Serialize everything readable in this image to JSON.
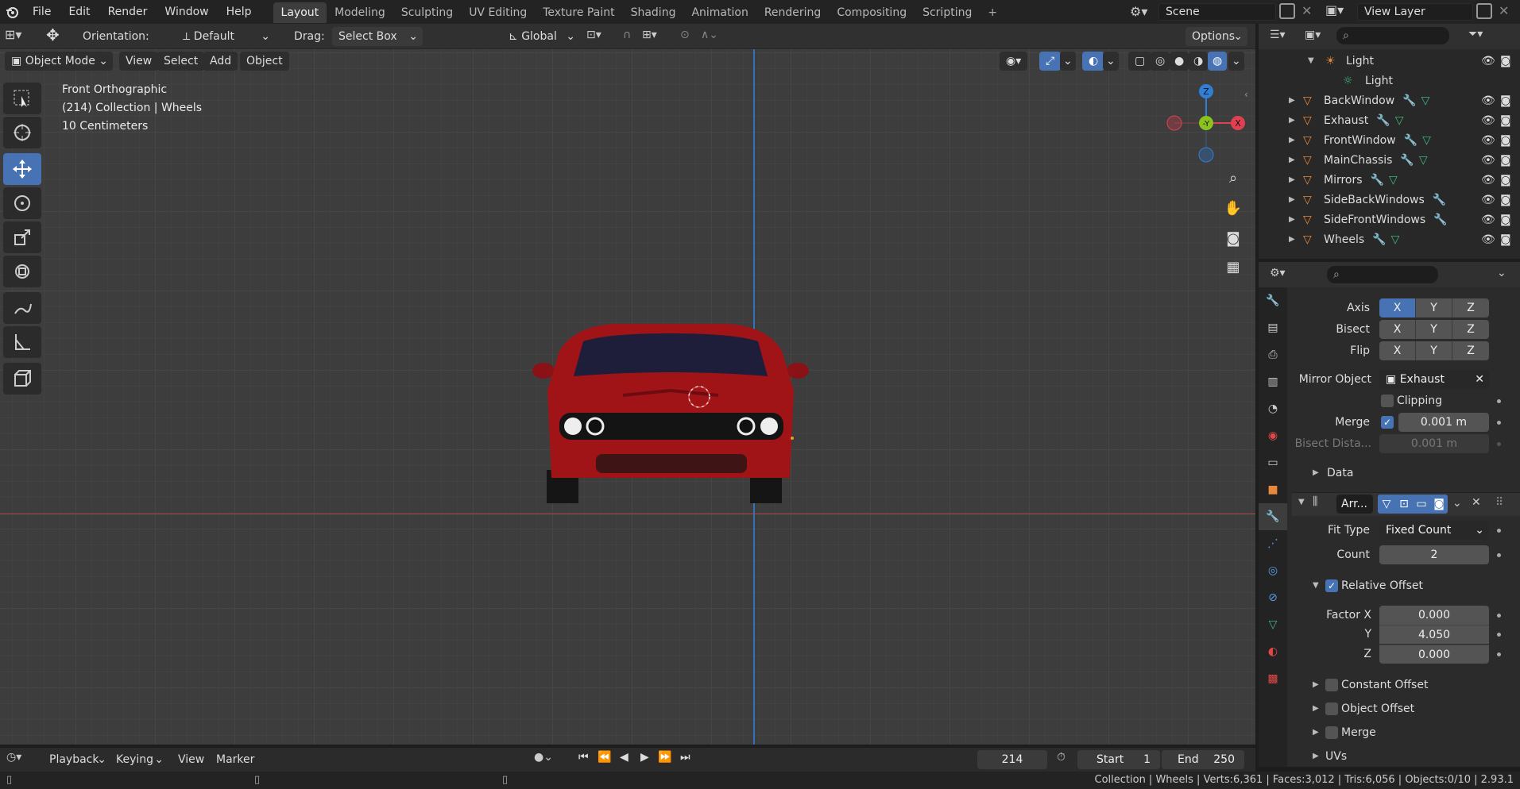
{
  "menu": {
    "file": "File",
    "edit": "Edit",
    "render": "Render",
    "window": "Window",
    "help": "Help"
  },
  "workspaces": [
    "Layout",
    "Modeling",
    "Sculpting",
    "UV Editing",
    "Texture Paint",
    "Shading",
    "Animation",
    "Rendering",
    "Compositing",
    "Scripting"
  ],
  "scene": {
    "name": "Scene",
    "view_layer": "View Layer"
  },
  "tool_header": {
    "orientation_label": "Orientation:",
    "orientation_value": "Default",
    "drag_label": "Drag:",
    "drag_value": "Select Box",
    "transform": "Global",
    "options": "Options"
  },
  "viewport_header": {
    "mode": "Object Mode",
    "view": "View",
    "select": "Select",
    "add": "Add",
    "object": "Object"
  },
  "viewport_info": {
    "view_name": "Front Orthographic",
    "collection": "(214) Collection | Wheels",
    "scale": "10 Centimeters"
  },
  "gizmo": {
    "z": "Z",
    "y": "-Y",
    "x": "X"
  },
  "outliner": {
    "light_parent": "Light",
    "light_child": "Light",
    "items": [
      "BackWindow",
      "Exhaust",
      "FrontWindow",
      "MainChassis",
      "Mirrors",
      "SideBackWindows",
      "SideFrontWindows",
      "Wheels"
    ],
    "selected": "Wheels"
  },
  "modifiers": {
    "mirror": {
      "axis_label": "Axis",
      "bisect_label": "Bisect",
      "flip_label": "Flip",
      "axes": [
        "X",
        "Y",
        "Z"
      ],
      "mirror_object_label": "Mirror Object",
      "mirror_object": "Exhaust",
      "clipping_label": "Clipping",
      "merge_label": "Merge",
      "merge_value": "0.001 m",
      "bisect_distance_label": "Bisect Dista...",
      "bisect_distance_value": "0.001 m",
      "data_label": "Data"
    },
    "array": {
      "name": "Arr...",
      "fit_type_label": "Fit Type",
      "fit_type": "Fixed Count",
      "count_label": "Count",
      "count": "2",
      "relative_offset_label": "Relative Offset",
      "factor_x_label": "Factor X",
      "factor_x": "0.000",
      "y_label": "Y",
      "y": "4.050",
      "z_label": "Z",
      "z": "0.000",
      "constant_offset_label": "Constant Offset",
      "object_offset_label": "Object Offset",
      "merge_label": "Merge",
      "uvs_label": "UVs"
    }
  },
  "timeline": {
    "playback": "Playback",
    "keying": "Keying",
    "view": "View",
    "marker": "Marker",
    "current_frame": "214",
    "start_label": "Start",
    "start": "1",
    "end_label": "End",
    "end": "250"
  },
  "status": {
    "text": "Collection | Wheels | Verts:6,361 | Faces:3,012 | Tris:6,056 | Objects:0/10 | 2.93.1"
  },
  "colors": {
    "accent": "#4772b3",
    "car": "#a01418",
    "x_axis": "#e04050",
    "y_axis": "#8cc21d",
    "z_axis": "#2f7fd6"
  }
}
